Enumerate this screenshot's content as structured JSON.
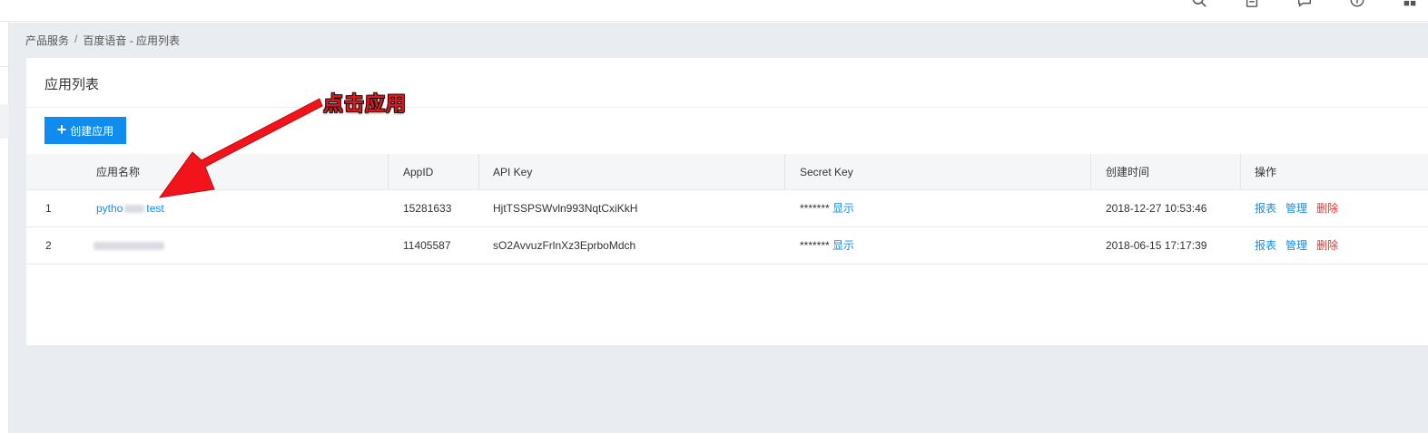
{
  "top_icons": [
    "search-icon",
    "clipboard-icon",
    "chat-icon",
    "help-icon",
    "grid-icon"
  ],
  "breadcrumb": {
    "items": [
      "产品服务",
      "百度语音 - 应用列表"
    ],
    "separator": "/"
  },
  "page": {
    "title": "应用列表",
    "create_button": "创建应用"
  },
  "table": {
    "headers": {
      "name": "应用名称",
      "appid": "AppID",
      "api_key": "API Key",
      "secret_key": "Secret Key",
      "created": "创建时间",
      "actions": "操作"
    },
    "rows": [
      {
        "index": "1",
        "name_prefix": "pytho",
        "name_suffix": "test",
        "appid": "15281633",
        "api_key": "HjtTSSPSWvln993NqtCxiKkH",
        "secret_mask": "*******",
        "secret_show": "显示",
        "created": "2018-12-27 10:53:46",
        "actions": [
          "报表",
          "管理",
          "删除"
        ]
      },
      {
        "index": "2",
        "name_prefix": "",
        "name_suffix": "",
        "appid": "11405587",
        "api_key": "sO2AvvuzFrlnXz3EprboMdch",
        "secret_mask": "*******",
        "secret_show": "显示",
        "created": "2018-06-15 17:17:39",
        "actions": [
          "报表",
          "管理",
          "删除"
        ]
      }
    ]
  },
  "annotation": {
    "text": "点击应用",
    "color": "#e8141a"
  },
  "colors": {
    "accent": "#108cee",
    "danger": "#ea2e2e",
    "background": "#e9ecf0"
  }
}
